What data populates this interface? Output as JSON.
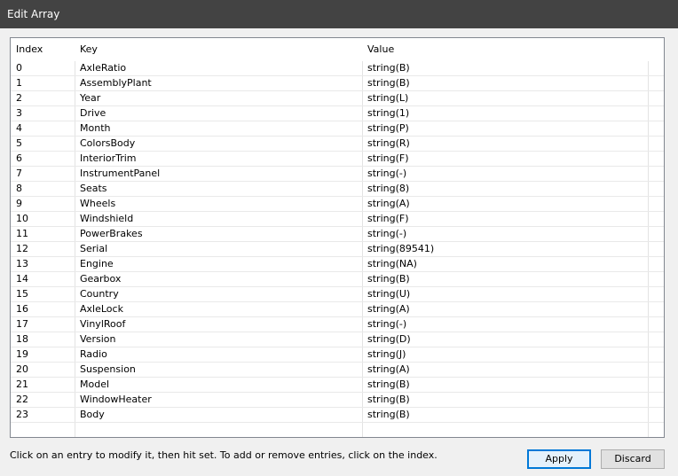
{
  "window": {
    "title": "Edit Array"
  },
  "table": {
    "columns": [
      "Index",
      "Key",
      "Value"
    ],
    "rows": [
      {
        "index": "0",
        "key": "AxleRatio",
        "value": "string(B)"
      },
      {
        "index": "1",
        "key": "AssemblyPlant",
        "value": "string(B)"
      },
      {
        "index": "2",
        "key": "Year",
        "value": "string(L)"
      },
      {
        "index": "3",
        "key": "Drive",
        "value": "string(1)"
      },
      {
        "index": "4",
        "key": "Month",
        "value": "string(P)"
      },
      {
        "index": "5",
        "key": "ColorsBody",
        "value": "string(R)"
      },
      {
        "index": "6",
        "key": "InteriorTrim",
        "value": "string(F)"
      },
      {
        "index": "7",
        "key": "InstrumentPanel",
        "value": "string(-)"
      },
      {
        "index": "8",
        "key": "Seats",
        "value": "string(8)"
      },
      {
        "index": "9",
        "key": "Wheels",
        "value": "string(A)"
      },
      {
        "index": "10",
        "key": "Windshield",
        "value": "string(F)"
      },
      {
        "index": "11",
        "key": "PowerBrakes",
        "value": "string(-)"
      },
      {
        "index": "12",
        "key": "Serial",
        "value": "string(89541)"
      },
      {
        "index": "13",
        "key": "Engine",
        "value": "string(NA)"
      },
      {
        "index": "14",
        "key": "Gearbox",
        "value": "string(B)"
      },
      {
        "index": "15",
        "key": "Country",
        "value": "string(U)"
      },
      {
        "index": "16",
        "key": "AxleLock",
        "value": "string(A)"
      },
      {
        "index": "17",
        "key": "VinylRoof",
        "value": "string(-)"
      },
      {
        "index": "18",
        "key": "Version",
        "value": "string(D)"
      },
      {
        "index": "19",
        "key": "Radio",
        "value": "string(J)"
      },
      {
        "index": "20",
        "key": "Suspension",
        "value": "string(A)"
      },
      {
        "index": "21",
        "key": "Model",
        "value": "string(B)"
      },
      {
        "index": "22",
        "key": "WindowHeater",
        "value": "string(B)"
      },
      {
        "index": "23",
        "key": "Body",
        "value": "string(B)"
      }
    ]
  },
  "footer": {
    "hint": "Click on an entry to modify it, then hit set. To add or remove entries, click on the index.",
    "apply_label": "Apply",
    "discard_label": "Discard"
  }
}
